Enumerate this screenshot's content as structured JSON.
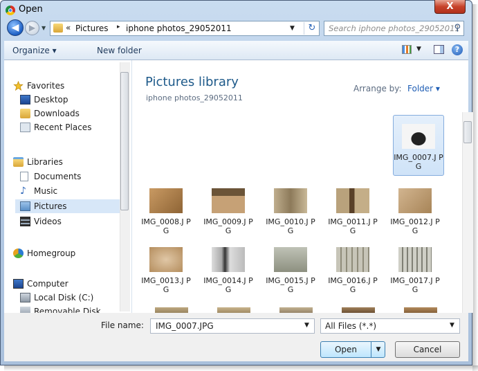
{
  "window": {
    "title": "Open",
    "close_glyph": "X"
  },
  "nav": {
    "back_glyph": "◀",
    "forward_glyph": "▶"
  },
  "address": {
    "overflow_chevron": "«",
    "breadcrumbs": [
      "Pictures",
      "iphone photos_29052011"
    ],
    "separator": "▸",
    "refresh_glyph": "↻"
  },
  "search": {
    "placeholder": "Search iphone photos_29052011"
  },
  "toolbar": {
    "organize_label": "Organize ▾",
    "new_folder_label": "New folder",
    "help_glyph": "?"
  },
  "sidebar": {
    "items": [
      {
        "label": "Favorites",
        "icon": "star-icon"
      },
      {
        "label": "Desktop",
        "icon": "desktop-icon"
      },
      {
        "label": "Downloads",
        "icon": "downloads-icon"
      },
      {
        "label": "Recent Places",
        "icon": "recent-places-icon"
      },
      {
        "label": "Libraries",
        "icon": "libraries-icon"
      },
      {
        "label": "Documents",
        "icon": "documents-icon"
      },
      {
        "label": "Music",
        "icon": "music-icon"
      },
      {
        "label": "Pictures",
        "icon": "pictures-icon",
        "selected": true
      },
      {
        "label": "Videos",
        "icon": "videos-icon"
      },
      {
        "label": "Homegroup",
        "icon": "homegroup-icon"
      },
      {
        "label": "Computer",
        "icon": "computer-icon"
      },
      {
        "label": "Local Disk (C:)",
        "icon": "local-disk-icon"
      },
      {
        "label": "Removable Disk",
        "icon": "removable-disk-icon"
      }
    ]
  },
  "library": {
    "title": "Pictures library",
    "subtitle": "iphone photos_29052011",
    "arrange_label": "Arrange by:",
    "arrange_value": "Folder ▾"
  },
  "files": [
    {
      "name": "IMG_0007.J PG",
      "selected": true
    },
    {
      "name": "IMG_0008.J PG"
    },
    {
      "name": "IMG_0009.J PG"
    },
    {
      "name": "IMG_0010.J PG"
    },
    {
      "name": "IMG_0011.J PG"
    },
    {
      "name": "IMG_0012.J PG"
    },
    {
      "name": "IMG_0013.J PG"
    },
    {
      "name": "IMG_0014.J PG"
    },
    {
      "name": "IMG_0015.J PG"
    },
    {
      "name": "IMG_0016.J PG"
    },
    {
      "name": "IMG_0017.J PG"
    }
  ],
  "footer": {
    "file_name_label": "File name:",
    "file_name_value": "IMG_0007.JPG",
    "filter_value": "All Files (*.*)",
    "open_label": "Open",
    "cancel_label": "Cancel"
  },
  "colors": {
    "accent": "#1e5a8a",
    "selection": "#cfe3f8",
    "link": "#1e5db4"
  }
}
